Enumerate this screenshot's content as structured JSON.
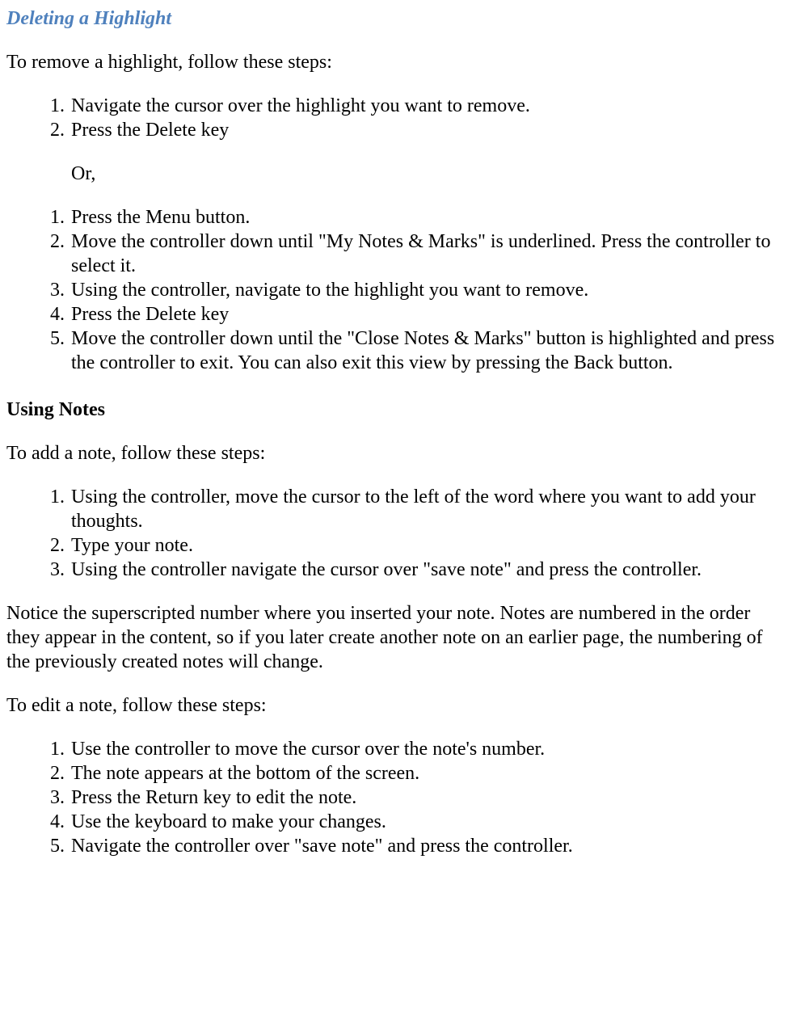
{
  "heading1": "Deleting a Highlight",
  "intro1": "To remove a highlight, follow these steps:",
  "list1": [
    "Navigate the cursor over the highlight you want to remove.",
    "Press the Delete key"
  ],
  "or_text": "Or,",
  "list2": [
    "Press the Menu button.",
    "Move the controller down until \"My Notes & Marks\" is underlined. Press the controller to select it.",
    "Using the controller, navigate to the highlight you want to remove.",
    "Press the Delete key",
    "Move the controller down until the \"Close Notes & Marks\" button is highlighted and press the controller to exit. You can also exit this view by pressing the Back button."
  ],
  "heading2": "Using Notes",
  "intro2": "To add a note, follow these steps:",
  "list3": [
    "Using the controller, move the cursor to the left of the word where you want to add your thoughts.",
    "Type your note.",
    "Using the controller navigate the cursor over \"save note\" and press the controller."
  ],
  "para1": "Notice the superscripted number where you inserted your note. Notes are numbered in the order they appear in the content, so if you later create another note on an earlier page, the numbering of the previously created notes will change.",
  "intro3": "To edit a note, follow these steps:",
  "list4": [
    "Use the controller to move the cursor over the note's number.",
    "The note appears at the bottom of the screen.",
    "Press the Return key to edit the note.",
    "Use the keyboard to make your changes.",
    "Navigate the controller over \"save note\" and press the controller."
  ]
}
